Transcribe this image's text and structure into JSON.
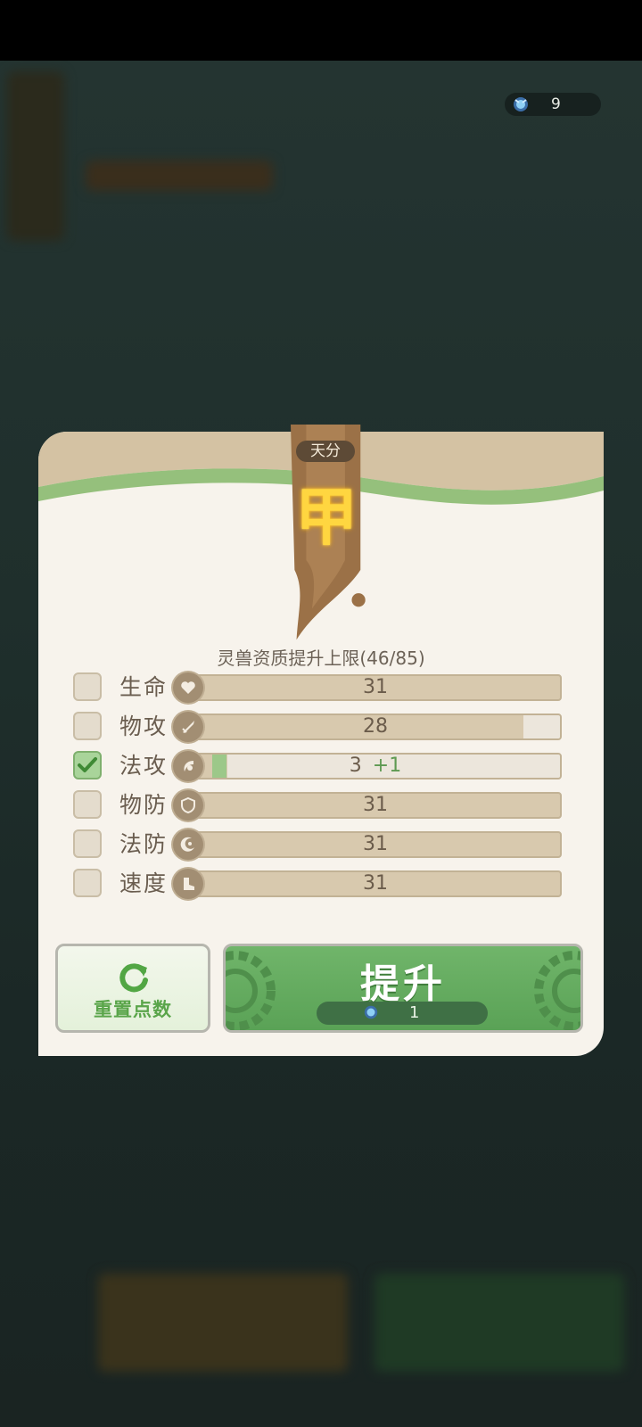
{
  "currency": {
    "icon": "spirit-gem-icon",
    "amount": "9"
  },
  "panel": {
    "tier_label": "天分",
    "grade": "甲",
    "limit_text": "灵兽资质提升上限(46/85)"
  },
  "stats": [
    {
      "name": "生命",
      "icon": "heart-icon",
      "value": "31",
      "plus": "",
      "checked": false,
      "fill": 1.0
    },
    {
      "name": "物攻",
      "icon": "sword-icon",
      "value": "28",
      "plus": "",
      "checked": false,
      "fill": 0.903
    },
    {
      "name": "法攻",
      "icon": "magic-icon",
      "value": "3",
      "plus": "+1",
      "checked": true,
      "fill": 0.097
    },
    {
      "name": "物防",
      "icon": "shield-icon",
      "value": "31",
      "plus": "",
      "checked": false,
      "fill": 1.0
    },
    {
      "name": "法防",
      "icon": "moon-icon",
      "value": "31",
      "plus": "",
      "checked": false,
      "fill": 1.0
    },
    {
      "name": "速度",
      "icon": "boot-icon",
      "value": "31",
      "plus": "",
      "checked": false,
      "fill": 1.0
    }
  ],
  "buttons": {
    "reset_label": "重置点数",
    "upgrade_label": "提升",
    "upgrade_cost": "1"
  },
  "colors": {
    "accent_green": "#5aa256",
    "panel_bg": "#f7f3ec",
    "grade_gold": "#ffd640"
  }
}
